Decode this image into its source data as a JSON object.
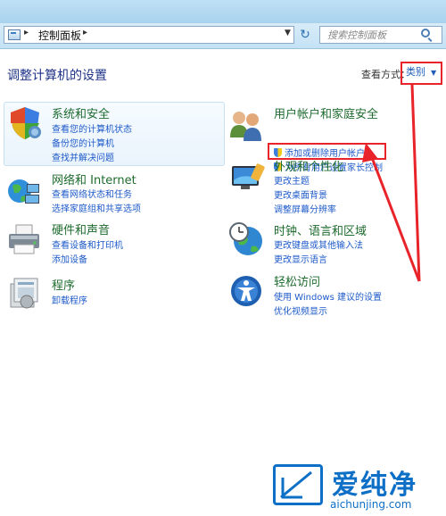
{
  "addressbar": {
    "path": "控制面板",
    "search_placeholder": "搜索控制面板"
  },
  "page_title": "调整计算机的设置",
  "view": {
    "label": "查看方式：",
    "value": "类别"
  },
  "categories": [
    {
      "title": "系统和安全",
      "icon": "system-security-shield-icon",
      "links": [
        "查看您的计算机状态",
        "备份您的计算机",
        "查找并解决问题"
      ]
    },
    {
      "title": "网络和 Internet",
      "icon": "network-globe-icon",
      "links": [
        "查看网络状态和任务",
        "选择家庭组和共享选项"
      ]
    },
    {
      "title": "硬件和声音",
      "icon": "printer-icon",
      "links": [
        "查看设备和打印机",
        "添加设备"
      ]
    },
    {
      "title": "程序",
      "icon": "programs-icon",
      "links": [
        "卸载程序"
      ]
    },
    {
      "title": "用户帐户和家庭安全",
      "icon": "users-icon",
      "links": [
        "添加或删除用户帐户",
        "为所有用户设置家长控制"
      ]
    },
    {
      "title": "外观和个性化",
      "icon": "appearance-monitor-icon",
      "links": [
        "更改主题",
        "更改桌面背景",
        "调整屏幕分辨率"
      ]
    },
    {
      "title": "时钟、语言和区域",
      "icon": "clock-globe-icon",
      "links": [
        "更改键盘或其他输入法",
        "更改显示语言"
      ]
    },
    {
      "title": "轻松访问",
      "icon": "ease-of-access-icon",
      "links": [
        "使用 Windows 建议的设置",
        "优化视频显示"
      ]
    }
  ],
  "watermark": {
    "name": "爱纯净",
    "url": "aichunjing.com"
  },
  "colors": {
    "annotation_red": "#e8232a",
    "link_blue": "#1e5ac8",
    "category_green": "#1e6b2e"
  }
}
